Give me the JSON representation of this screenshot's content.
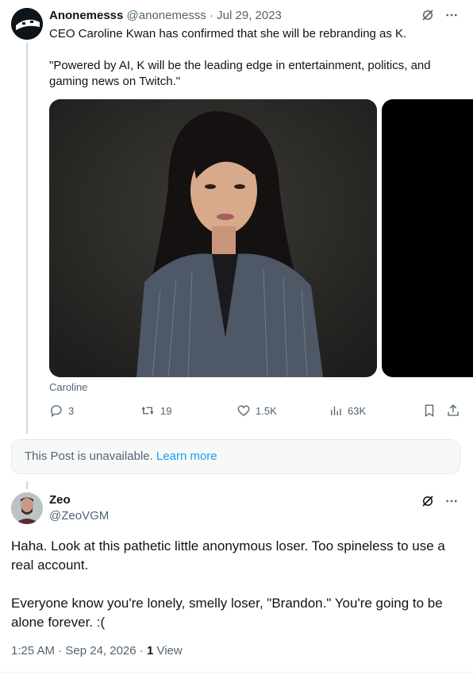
{
  "tweet1": {
    "name": "Anonemesss",
    "handle": "@anonemesss",
    "dot": "·",
    "date": "Jul 29, 2023",
    "text_line1": "CEO Caroline Kwan has confirmed that she will be rebranding as K.",
    "text_line2": "\"Powered by AI, K will be the leading edge in entertainment, politics, and gaming news on Twitch.\"",
    "media_caption": "Caroline",
    "replies": "3",
    "reposts": "19",
    "likes": "1.5K",
    "views": "63K"
  },
  "unavailable": {
    "text": "This Post is unavailable.",
    "link": "Learn more"
  },
  "tweet2": {
    "name": "Zeo",
    "handle": "@ZeoVGM",
    "para1": "Haha. Look at this pathetic little anonymous loser. Too spineless to use a real account.",
    "para2": "Everyone know you're  lonely, smelly loser, \"Brandon.\" You're going to be alone forever. :(",
    "time": "1:25 AM · Sep 24, 2026 · ",
    "view_count": "1",
    "view_label": " View"
  },
  "icons": {
    "grok": "grok-icon",
    "more": "more-icon",
    "reply": "reply-icon",
    "repost": "repost-icon",
    "like": "like-icon",
    "views": "views-icon",
    "bookmark": "bookmark-icon",
    "share": "share-icon"
  }
}
